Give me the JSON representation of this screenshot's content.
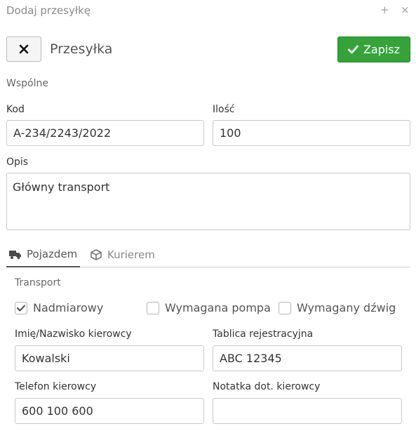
{
  "window": {
    "title": "Dodaj przesyłkę",
    "plus_glyph": "+",
    "close_glyph": "×"
  },
  "header": {
    "title": "Przesyłka",
    "save_label": "Zapisz",
    "close_icon": "x-icon",
    "save_icon": "check-icon"
  },
  "common": {
    "section_title": "Wspólne",
    "kod": {
      "label": "Kod",
      "value": "A-234/2243/2022"
    },
    "ilosc": {
      "label": "Ilość",
      "value": "100"
    },
    "opis": {
      "label": "Opis",
      "value": "Główny transport"
    }
  },
  "tabs": [
    {
      "label": "Pojazdem",
      "icon": "truck-icon",
      "active": true
    },
    {
      "label": "Kurierem",
      "icon": "package-icon",
      "active": false
    }
  ],
  "transport": {
    "section_title": "Transport",
    "checkboxes": [
      {
        "label": "Nadmiarowy",
        "checked": true
      },
      {
        "label": "Wymagana pompa",
        "checked": false
      },
      {
        "label": "Wymagany dźwig",
        "checked": false
      }
    ],
    "driver_name": {
      "label": "Imię/Nazwisko kierowcy",
      "value": "Kowalski"
    },
    "plate": {
      "label": "Tablica rejestracyjna",
      "value": "ABC 12345"
    },
    "phone": {
      "label": "Telefon kierowcy",
      "value": "600 100 600"
    },
    "note": {
      "label": "Notatka dot. kierowcy",
      "value": ""
    }
  },
  "colors": {
    "accent_green": "#36a33a",
    "border": "#c9c9c9",
    "muted_text": "#8a8a8a"
  }
}
